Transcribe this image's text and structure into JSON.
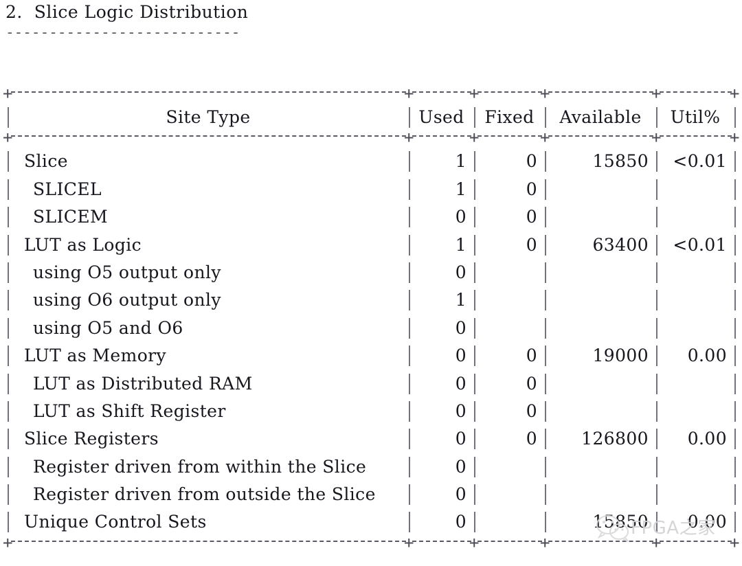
{
  "document": {
    "section_number": "2.",
    "section_title": "2.  Slice Logic Distribution",
    "rule": "---------------------------"
  },
  "table": {
    "columns": [
      {
        "key": "site_type",
        "label": "Site Type",
        "align": "center"
      },
      {
        "key": "used",
        "label": "Used",
        "align": "right"
      },
      {
        "key": "fixed",
        "label": "Fixed",
        "align": "right"
      },
      {
        "key": "available",
        "label": "Available",
        "align": "right"
      },
      {
        "key": "util",
        "label": "Util%",
        "align": "right"
      }
    ],
    "rows": [
      {
        "indent": 1,
        "site_type": "Slice",
        "used": "1",
        "fixed": "0",
        "available": "15850",
        "util": "<0.01"
      },
      {
        "indent": 2,
        "site_type": "SLICEL",
        "used": "1",
        "fixed": "0",
        "available": "",
        "util": ""
      },
      {
        "indent": 2,
        "site_type": "SLICEM",
        "used": "0",
        "fixed": "0",
        "available": "",
        "util": ""
      },
      {
        "indent": 1,
        "site_type": "LUT as Logic",
        "used": "1",
        "fixed": "0",
        "available": "63400",
        "util": "<0.01"
      },
      {
        "indent": 2,
        "site_type": "using O5 output only",
        "used": "0",
        "fixed": "",
        "available": "",
        "util": ""
      },
      {
        "indent": 2,
        "site_type": "using O6 output only",
        "used": "1",
        "fixed": "",
        "available": "",
        "util": ""
      },
      {
        "indent": 2,
        "site_type": "using O5 and O6",
        "used": "0",
        "fixed": "",
        "available": "",
        "util": ""
      },
      {
        "indent": 1,
        "site_type": "LUT as Memory",
        "used": "0",
        "fixed": "0",
        "available": "19000",
        "util": "0.00"
      },
      {
        "indent": 2,
        "site_type": "LUT as Distributed RAM",
        "used": "0",
        "fixed": "0",
        "available": "",
        "util": ""
      },
      {
        "indent": 2,
        "site_type": "LUT as Shift Register",
        "used": "0",
        "fixed": "0",
        "available": "",
        "util": ""
      },
      {
        "indent": 1,
        "site_type": "Slice Registers",
        "used": "0",
        "fixed": "0",
        "available": "126800",
        "util": "0.00"
      },
      {
        "indent": 2,
        "site_type": "Register driven from within the Slice",
        "used": "0",
        "fixed": "",
        "available": "",
        "util": ""
      },
      {
        "indent": 2,
        "site_type": "Register driven from outside the Slice",
        "used": "0",
        "fixed": "",
        "available": "",
        "util": ""
      },
      {
        "indent": 1,
        "site_type": "Unique Control Sets",
        "used": "0",
        "fixed": "",
        "available": "15850",
        "util": "0.00"
      }
    ]
  },
  "watermark": {
    "text": "FPGA之家",
    "logo": "wechat-icon",
    "color": "#d2d2d2"
  },
  "colors": {
    "background": "#ffffff",
    "text": "#16161e",
    "rule": "#5a5a64",
    "pipe": "#72727e"
  }
}
